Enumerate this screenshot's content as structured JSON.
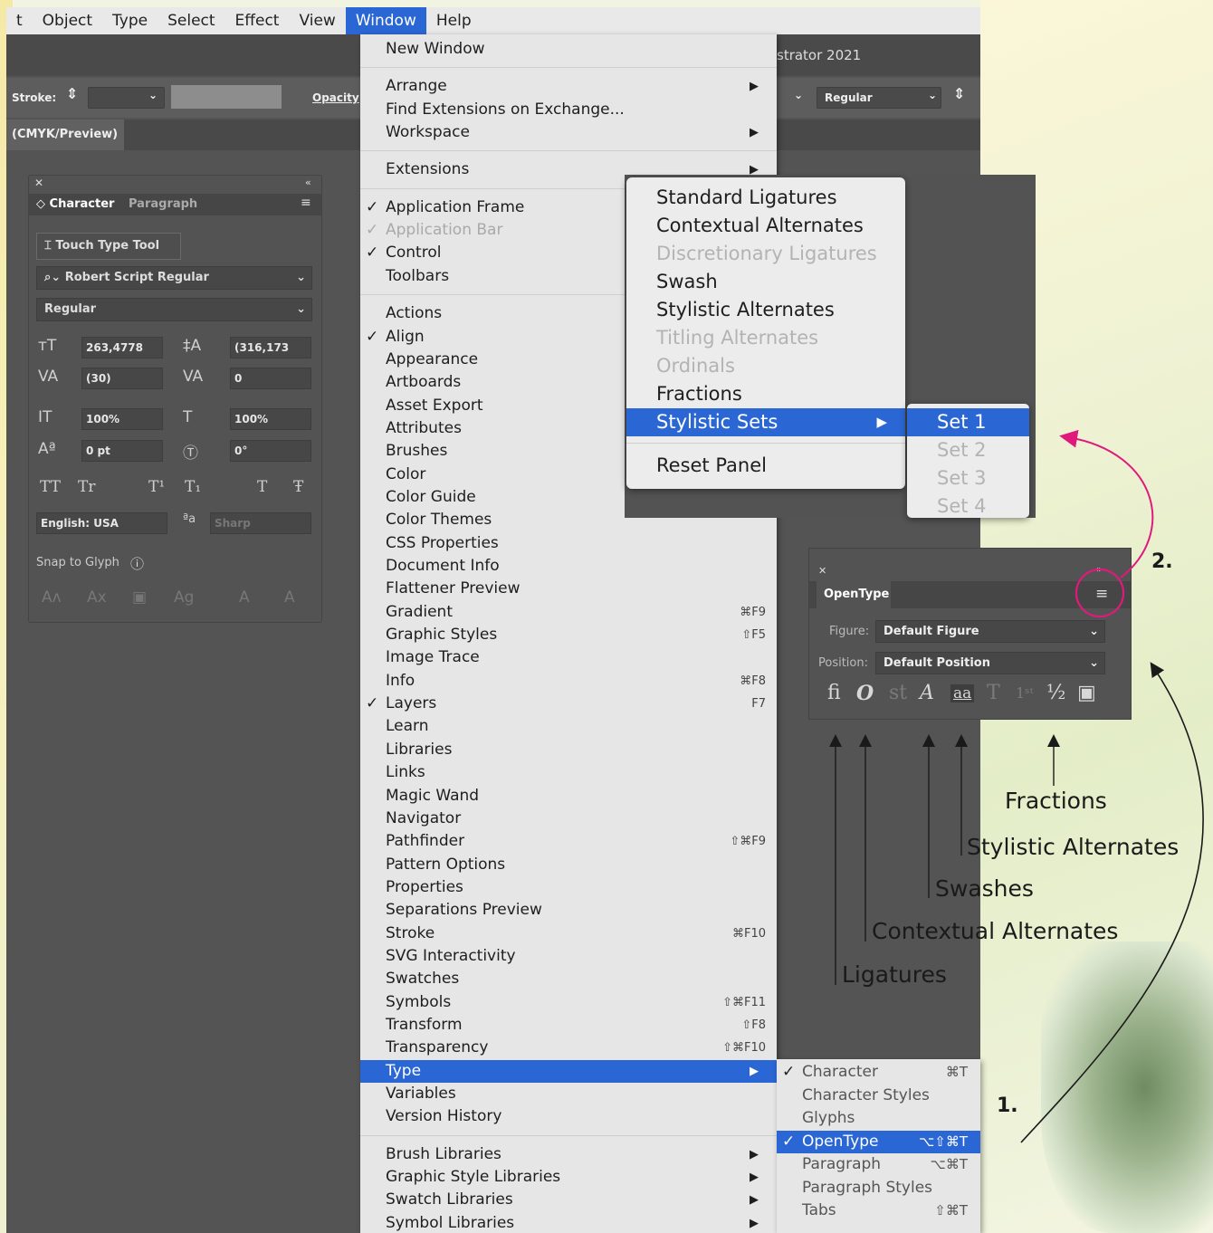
{
  "menubar": {
    "items": [
      "t",
      "Object",
      "Type",
      "Select",
      "Effect",
      "View",
      "Window",
      "Help"
    ],
    "active": "Window"
  },
  "titlebar": {
    "title": "strator 2021"
  },
  "controlbar": {
    "stroke_label": "Stroke:",
    "opacity_label": "Opacity",
    "font_style": "Regular"
  },
  "doc_tab": {
    "label": "(CMYK/Preview)"
  },
  "character_panel": {
    "tabs": [
      "Character",
      "Paragraph"
    ],
    "touch_type_label": "Touch Type Tool",
    "font_family": "Robert Script Regular",
    "font_style": "Regular",
    "font_size": "263,4778",
    "leading": "(316,173",
    "kerning": "(30)",
    "tracking": "0",
    "vertical_scale": "100%",
    "horizontal_scale": "100%",
    "baseline_shift": "0 pt",
    "rotation": "0°",
    "language": "English: USA",
    "anti_alias": "Sharp",
    "snap_label": "Snap to Glyph"
  },
  "window_menu": {
    "items": [
      {
        "label": "New Window"
      },
      {
        "label": "Arrange",
        "submenu": true
      },
      {
        "label": "Find Extensions on Exchange..."
      },
      {
        "label": "Workspace",
        "submenu": true
      },
      {
        "label": "Extensions",
        "submenu": true
      },
      {
        "label": "Application Frame",
        "checked": true
      },
      {
        "label": "Application Bar",
        "checked": true,
        "disabled": true
      },
      {
        "label": "Control",
        "checked": true
      },
      {
        "label": "Toolbars"
      },
      {
        "label": "Actions"
      },
      {
        "label": "Align",
        "checked": true
      },
      {
        "label": "Appearance"
      },
      {
        "label": "Artboards"
      },
      {
        "label": "Asset Export"
      },
      {
        "label": "Attributes"
      },
      {
        "label": "Brushes"
      },
      {
        "label": "Color"
      },
      {
        "label": "Color Guide"
      },
      {
        "label": "Color Themes"
      },
      {
        "label": "CSS Properties"
      },
      {
        "label": "Document Info"
      },
      {
        "label": "Flattener Preview"
      },
      {
        "label": "Gradient",
        "shortcut": "⌘F9"
      },
      {
        "label": "Graphic Styles",
        "shortcut": "⇧F5"
      },
      {
        "label": "Image Trace"
      },
      {
        "label": "Info",
        "shortcut": "⌘F8"
      },
      {
        "label": "Layers",
        "checked": true,
        "shortcut": "F7"
      },
      {
        "label": "Learn"
      },
      {
        "label": "Libraries"
      },
      {
        "label": "Links"
      },
      {
        "label": "Magic Wand"
      },
      {
        "label": "Navigator"
      },
      {
        "label": "Pathfinder",
        "shortcut": "⇧⌘F9"
      },
      {
        "label": "Pattern Options"
      },
      {
        "label": "Properties"
      },
      {
        "label": "Separations Preview"
      },
      {
        "label": "Stroke",
        "shortcut": "⌘F10"
      },
      {
        "label": "SVG Interactivity"
      },
      {
        "label": "Swatches"
      },
      {
        "label": "Symbols",
        "shortcut": "⇧⌘F11"
      },
      {
        "label": "Transform",
        "shortcut": "⇧F8"
      },
      {
        "label": "Transparency",
        "shortcut": "⇧⌘F10"
      },
      {
        "label": "Type",
        "submenu": true,
        "highlighted": true
      },
      {
        "label": "Variables"
      },
      {
        "label": "Version History"
      },
      {
        "label": "Brush Libraries",
        "submenu": true
      },
      {
        "label": "Graphic Style Libraries",
        "submenu": true
      },
      {
        "label": "Swatch Libraries",
        "submenu": true
      },
      {
        "label": "Symbol Libraries",
        "submenu": true
      }
    ]
  },
  "type_submenu": {
    "items": [
      {
        "label": "Character",
        "checked": true,
        "shortcut": "⌘T"
      },
      {
        "label": "Character Styles"
      },
      {
        "label": "Glyphs"
      },
      {
        "label": "OpenType",
        "checked": true,
        "shortcut": "⌥⇧⌘T",
        "highlighted": true
      },
      {
        "label": "Paragraph",
        "shortcut": "⌥⌘T"
      },
      {
        "label": "Paragraph Styles"
      },
      {
        "label": "Tabs",
        "shortcut": "⇧⌘T"
      }
    ]
  },
  "opentype_flyout": {
    "items": [
      {
        "label": "Standard Ligatures"
      },
      {
        "label": "Contextual Alternates"
      },
      {
        "label": "Discretionary Ligatures",
        "disabled": true
      },
      {
        "label": "Swash"
      },
      {
        "label": "Stylistic Alternates"
      },
      {
        "label": "Titling Alternates",
        "disabled": true
      },
      {
        "label": "Ordinals",
        "disabled": true
      },
      {
        "label": "Fractions"
      },
      {
        "label": "Stylistic Sets",
        "highlighted": true,
        "submenu": true
      },
      {
        "label": "Reset Panel"
      }
    ],
    "sets": [
      "Set 1",
      "Set 2",
      "Set 3",
      "Set 4"
    ]
  },
  "opentype_panel": {
    "tab": "OpenType",
    "figure_label": "Figure:",
    "figure_value": "Default Figure",
    "position_label": "Position:",
    "position_value": "Default Position"
  },
  "annotations": {
    "fractions": "Fractions",
    "stylistic_alternates": "Stylistic Alternates",
    "swashes": "Swashes",
    "contextual_alternates": "Contextual Alternates",
    "ligatures": "Ligatures",
    "step1": "1.",
    "step2": "2."
  },
  "colors": {
    "menu_highlight": "#2a67d4",
    "annotation_pink": "#e0197d",
    "panel_bg": "#535353"
  }
}
